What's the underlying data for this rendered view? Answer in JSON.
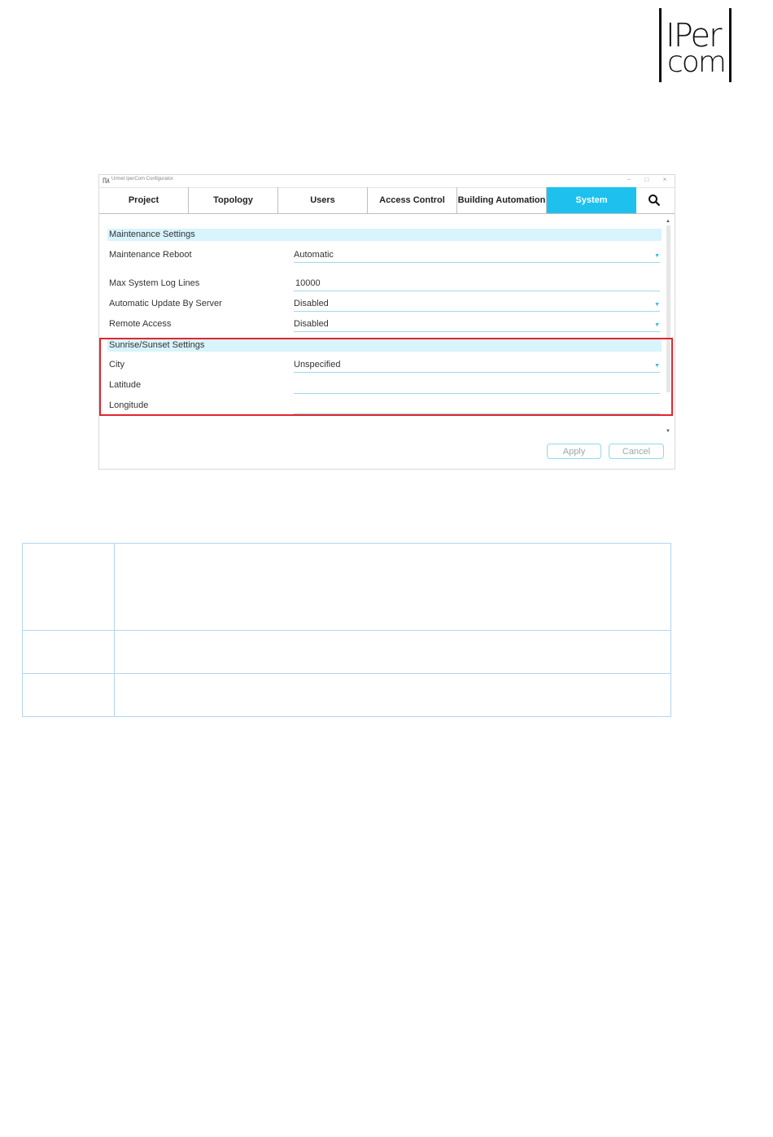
{
  "logo": {
    "line1": "IPer",
    "line2": "com"
  },
  "window": {
    "title": "Urmet IperCom Configurator",
    "controls": {
      "minimize": "–",
      "maximize": "□",
      "close": "×"
    }
  },
  "tabs": [
    {
      "label": "Project",
      "active": false
    },
    {
      "label": "Topology",
      "active": false
    },
    {
      "label": "Users",
      "active": false
    },
    {
      "label": "Access Control",
      "active": false
    },
    {
      "label": "Building Automation",
      "active": false
    },
    {
      "label": "System",
      "active": true
    }
  ],
  "maintenance": {
    "section": "Maintenance Settings",
    "reboot_label": "Maintenance Reboot",
    "reboot_value": "Automatic",
    "log_label": "Max System Log Lines",
    "log_value": "10000",
    "update_label": "Automatic Update By Server",
    "update_value": "Disabled",
    "remote_label": "Remote Access",
    "remote_value": "Disabled"
  },
  "sunrise": {
    "section": "Sunrise/Sunset Settings",
    "city_label": "City",
    "city_value": "Unspecified",
    "latitude_label": "Latitude",
    "latitude_value": "",
    "longitude_label": "Longitude",
    "longitude_value": ""
  },
  "buttons": {
    "apply": "Apply",
    "cancel": "Cancel"
  },
  "colors": {
    "accent": "#1ec1ee",
    "highlight": "#e0262d",
    "section_bg": "#d8f4fc",
    "table_border": "#b3d6ef"
  },
  "icons": {
    "search": "search-icon",
    "dropdown": "caret-down-icon"
  }
}
